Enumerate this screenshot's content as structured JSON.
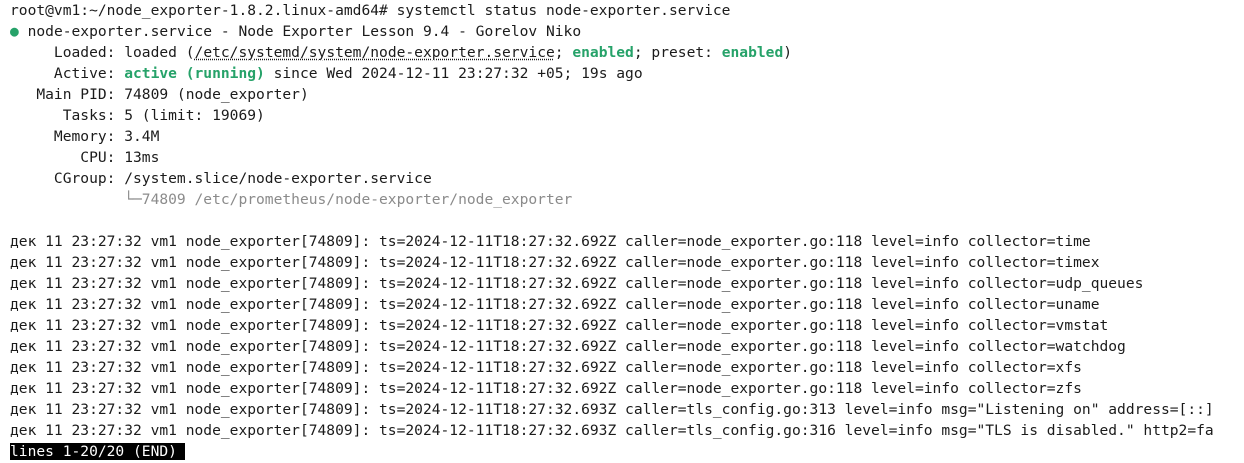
{
  "prompt": "root@vm1:~/node_exporter-1.8.2.linux-amd64# systemctl status node-exporter.service",
  "service": {
    "bullet": "●",
    "title": " node-exporter.service - Node Exporter Lesson 9.4 - Gorelov Niko",
    "loaded": {
      "label": "     Loaded: ",
      "pre": "loaded (",
      "path": "/etc/systemd/system/node-exporter.service",
      "sep1": "; ",
      "enabled1": "enabled",
      "sep2": "; preset: ",
      "enabled2": "enabled",
      "post": ")"
    },
    "active": {
      "label": "     Active: ",
      "state": "active (running)",
      "rest": " since Wed 2024-12-11 23:27:32 +05; 19s ago"
    },
    "main_pid": "   Main PID: 74809 (node_exporter)",
    "tasks": "      Tasks: 5 (limit: 19069)",
    "memory": "     Memory: 3.4M",
    "cpu": "        CPU: 13ms",
    "cgroup": "     CGroup: /system.slice/node-exporter.service",
    "cgroup_child": "             └─74809 /etc/prometheus/node-exporter/node_exporter"
  },
  "log_lines": [
    "дек 11 23:27:32 vm1 node_exporter[74809]: ts=2024-12-11T18:27:32.692Z caller=node_exporter.go:118 level=info collector=time",
    "дек 11 23:27:32 vm1 node_exporter[74809]: ts=2024-12-11T18:27:32.692Z caller=node_exporter.go:118 level=info collector=timex",
    "дек 11 23:27:32 vm1 node_exporter[74809]: ts=2024-12-11T18:27:32.692Z caller=node_exporter.go:118 level=info collector=udp_queues",
    "дек 11 23:27:32 vm1 node_exporter[74809]: ts=2024-12-11T18:27:32.692Z caller=node_exporter.go:118 level=info collector=uname",
    "дек 11 23:27:32 vm1 node_exporter[74809]: ts=2024-12-11T18:27:32.692Z caller=node_exporter.go:118 level=info collector=vmstat",
    "дек 11 23:27:32 vm1 node_exporter[74809]: ts=2024-12-11T18:27:32.692Z caller=node_exporter.go:118 level=info collector=watchdog",
    "дек 11 23:27:32 vm1 node_exporter[74809]: ts=2024-12-11T18:27:32.692Z caller=node_exporter.go:118 level=info collector=xfs",
    "дек 11 23:27:32 vm1 node_exporter[74809]: ts=2024-12-11T18:27:32.692Z caller=node_exporter.go:118 level=info collector=zfs",
    "дек 11 23:27:32 vm1 node_exporter[74809]: ts=2024-12-11T18:27:32.693Z caller=tls_config.go:313 level=info msg=\"Listening on\" address=[::]",
    "дек 11 23:27:32 vm1 node_exporter[74809]: ts=2024-12-11T18:27:32.693Z caller=tls_config.go:316 level=info msg=\"TLS is disabled.\" http2=fa"
  ],
  "pager_status": "lines 1-20/20 (END)",
  "colors": {
    "background": "#ffffff",
    "text": "#1b1b1b",
    "accent_green": "#26a269",
    "muted": "#8b8b8b",
    "pager_bg": "#000000"
  }
}
